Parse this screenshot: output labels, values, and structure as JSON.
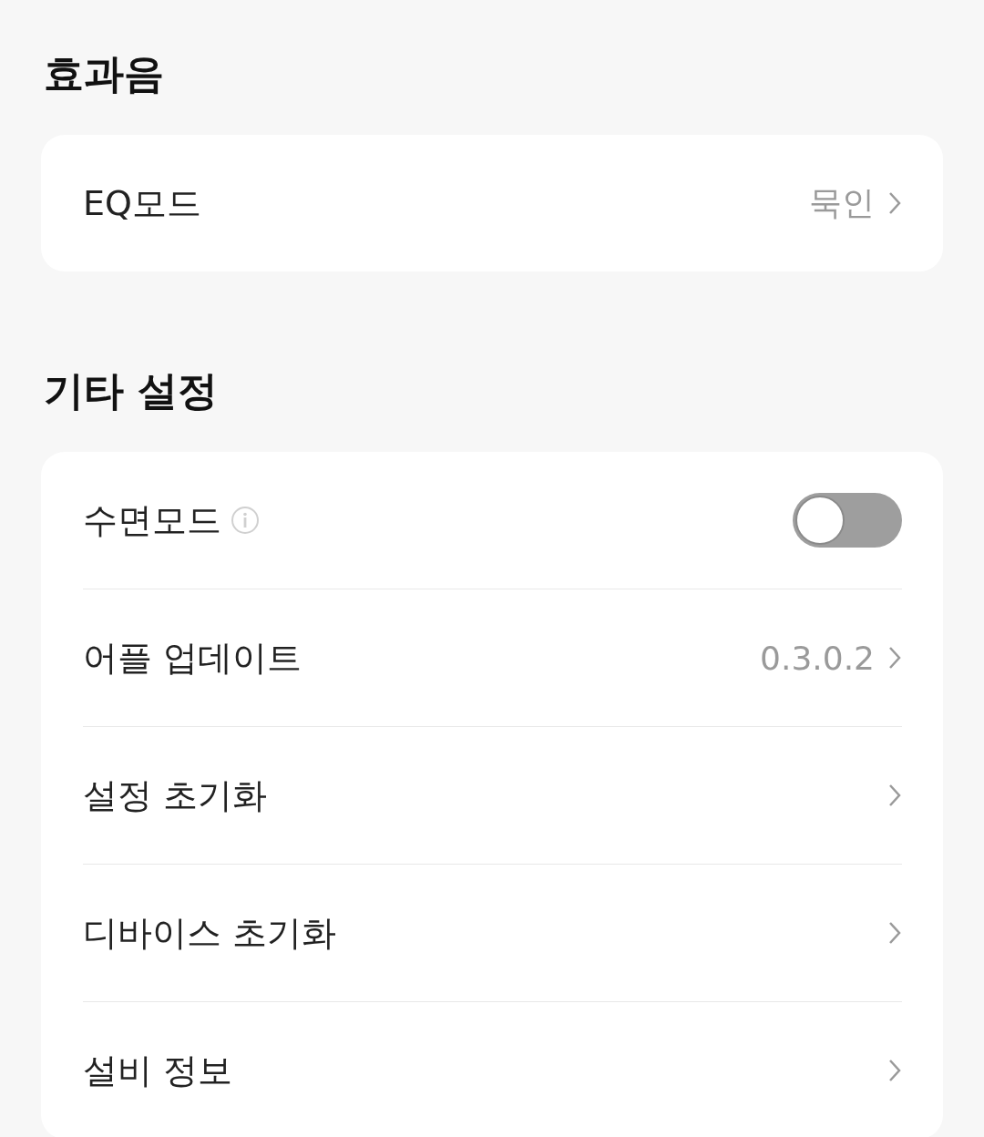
{
  "sections": [
    {
      "title": "효과음",
      "rows": [
        {
          "kind": "link",
          "label": "EQ모드",
          "value": "묵인"
        }
      ]
    },
    {
      "title": "기타 설정",
      "rows": [
        {
          "kind": "toggle",
          "label": "수면모드",
          "info_icon": true,
          "on": false
        },
        {
          "kind": "link",
          "label": "어플 업데이트",
          "value": "0.3.0.2"
        },
        {
          "kind": "link",
          "label": "설정 초기화"
        },
        {
          "kind": "link",
          "label": "디바이스 초기화"
        },
        {
          "kind": "link",
          "label": "설비 정보"
        }
      ]
    }
  ]
}
